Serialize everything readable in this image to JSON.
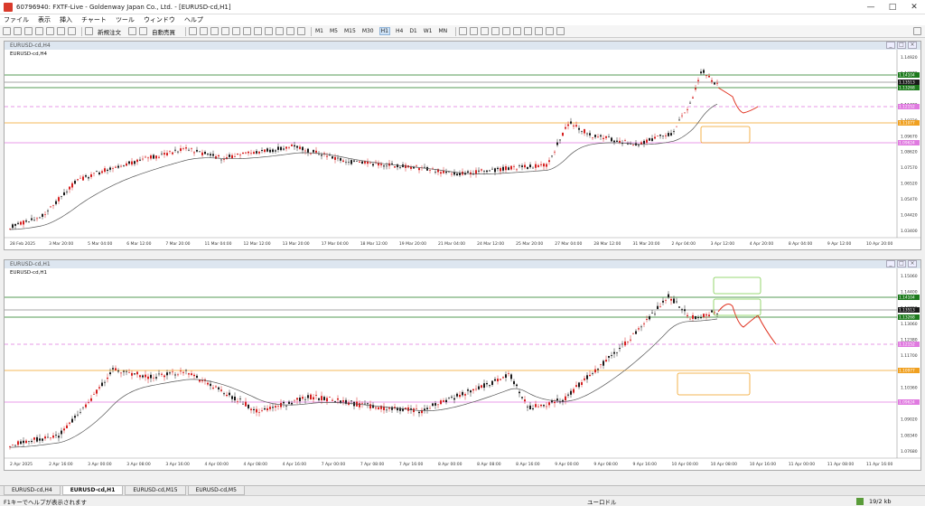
{
  "window": {
    "title": "60796940: FXTF-Live - Goldenway Japan Co., Ltd. - [EURUSD-cd,H1]"
  },
  "menu": [
    "ファイル",
    "表示",
    "挿入",
    "チャート",
    "ツール",
    "ウィンドウ",
    "ヘルプ"
  ],
  "toolbar": {
    "new_order": "新規注文",
    "auto_trade": "自動売買",
    "timeframes": [
      "M1",
      "M5",
      "M15",
      "M30",
      "H1",
      "H4",
      "D1",
      "W1",
      "MN"
    ],
    "active_tf": "H1"
  },
  "chart_h4": {
    "window_title": "EURUSD-cd,H4",
    "label": "EURUSD-cd,H4",
    "price_ticks": [
      "1.14920",
      "1.13870",
      "1.12820",
      "1.11770",
      "1.10720",
      "1.09670",
      "1.08620",
      "1.07570",
      "1.06520",
      "1.05470",
      "1.04420",
      "1.03400"
    ],
    "price_labels": [
      {
        "text": "1.14104",
        "color": "#1d7a1d"
      },
      {
        "text": "1.13513",
        "color": "#1a1a1a"
      },
      {
        "text": "1.13268",
        "color": "#1d7a1d"
      },
      {
        "text": "1.12152",
        "color": "#e07ae0"
      },
      {
        "text": "1.11077",
        "color": "#f0a020"
      },
      {
        "text": "1.09624",
        "color": "#e07ae0"
      }
    ],
    "time_ticks": [
      "28 Feb 2025",
      "3 Mar 20:00",
      "5 Mar 04:00",
      "6 Mar 12:00",
      "7 Mar 20:00",
      "11 Mar 04:00",
      "12 Mar 12:00",
      "13 Mar 20:00",
      "17 Mar 04:00",
      "18 Mar 12:00",
      "19 Mar 20:00",
      "21 Mar 04:00",
      "24 Mar 12:00",
      "25 Mar 20:00",
      "27 Mar 04:00",
      "28 Mar 12:00",
      "31 Mar 20:00",
      "2 Apr 04:00",
      "3 Apr 12:00",
      "4 Apr 20:00",
      "8 Apr 04:00",
      "9 Apr 12:00",
      "10 Apr 20:00"
    ]
  },
  "chart_h1": {
    "window_title": "EURUSD-cd,H1",
    "label": "EURUSD-cd,H1",
    "price_ticks": [
      "1.15060",
      "1.14400",
      "1.13720",
      "1.13060",
      "1.12380",
      "1.11700",
      "1.11040",
      "1.10360",
      "1.09700",
      "1.09020",
      "1.08340",
      "1.07680"
    ],
    "price_labels": [
      {
        "text": "1.14104",
        "color": "#1d7a1d"
      },
      {
        "text": "1.13513",
        "color": "#1a1a1a"
      },
      {
        "text": "1.13268",
        "color": "#1d7a1d"
      },
      {
        "text": "1.12152",
        "color": "#e07ae0"
      },
      {
        "text": "1.10977",
        "color": "#f0a020"
      },
      {
        "text": "1.09624",
        "color": "#e07ae0"
      }
    ],
    "time_ticks": [
      "2 Apr 2025",
      "2 Apr 16:00",
      "3 Apr 00:00",
      "3 Apr 08:00",
      "3 Apr 16:00",
      "4 Apr 00:00",
      "4 Apr 08:00",
      "4 Apr 16:00",
      "7 Apr 00:00",
      "7 Apr 08:00",
      "7 Apr 16:00",
      "8 Apr 00:00",
      "8 Apr 08:00",
      "8 Apr 16:00",
      "9 Apr 00:00",
      "9 Apr 08:00",
      "9 Apr 16:00",
      "10 Apr 00:00",
      "10 Apr 08:00",
      "10 Apr 16:00",
      "11 Apr 00:00",
      "11 Apr 08:00",
      "11 Apr 16:00"
    ]
  },
  "tabs": [
    "EURUSD-cd,H4",
    "EURUSD-cd,H1",
    "EURUSD-cd,M15",
    "EURUSD-cd,M5"
  ],
  "active_tab": "EURUSD-cd,H1",
  "status": {
    "help": "F1キーでヘルプが表示されます",
    "profile": "ユーロドル",
    "traffic": "19/2 kb"
  },
  "colors": {
    "bull": "#1b1b1b",
    "bear": "#d62020",
    "ma": "#555555",
    "zigzag": "#e0301e",
    "support": "#f0a020",
    "resist": "#1d7a1d",
    "pink": "#e07ae0"
  }
}
